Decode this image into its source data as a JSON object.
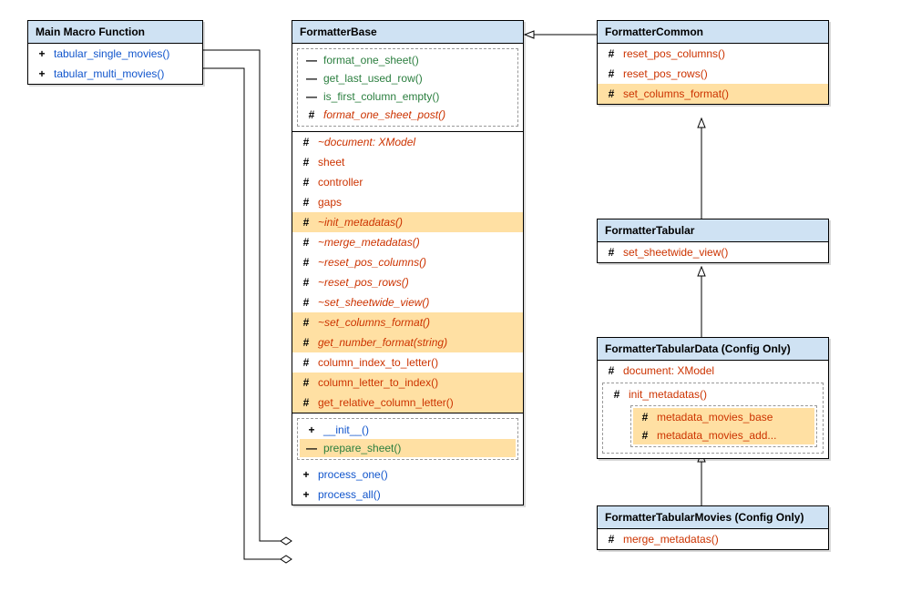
{
  "mainMacro": {
    "title": "Main Macro Function",
    "m1": "tabular_single_movies()",
    "m2": "tabular_multi_movies()"
  },
  "formatterBase": {
    "title": "FormatterBase",
    "grp1": {
      "a": "format_one_sheet()",
      "b": "get_last_used_row()",
      "c": "is_first_column_empty()",
      "d": "format_one_sheet_post()"
    },
    "sec2": {
      "a": "~document: XModel",
      "b": "sheet",
      "c": "controller",
      "d": "gaps",
      "e": "~init_metadatas()",
      "f": "~merge_metadatas()",
      "g": "~reset_pos_columns()",
      "h": "~reset_pos_rows()",
      "i": "~set_sheetwide_view()",
      "j": "~set_columns_format()",
      "k": "get_number_format(string)",
      "l": "column_index_to_letter()",
      "m": "column_letter_to_index()",
      "n": "get_relative_column_letter()"
    },
    "sec3": {
      "a": "__init__()",
      "b": "prepare_sheet()",
      "c": "process_one()",
      "d": "process_all()"
    }
  },
  "formatterCommon": {
    "title": "FormatterCommon",
    "a": "reset_pos_columns()",
    "b": "reset_pos_rows()",
    "c": "set_columns_format()"
  },
  "formatterTabular": {
    "title": "FormatterTabular",
    "a": "set_sheetwide_view()"
  },
  "formatterTabularData": {
    "title": "FormatterTabularData (Config Only)",
    "a": "document: XModel",
    "b": "init_metadatas()",
    "c": "metadata_movies_base",
    "d": "metadata_movies_add..."
  },
  "formatterTabularMovies": {
    "title": "FormatterTabularMovies (Config Only)",
    "a": "merge_metadatas()"
  },
  "chart_data": null
}
